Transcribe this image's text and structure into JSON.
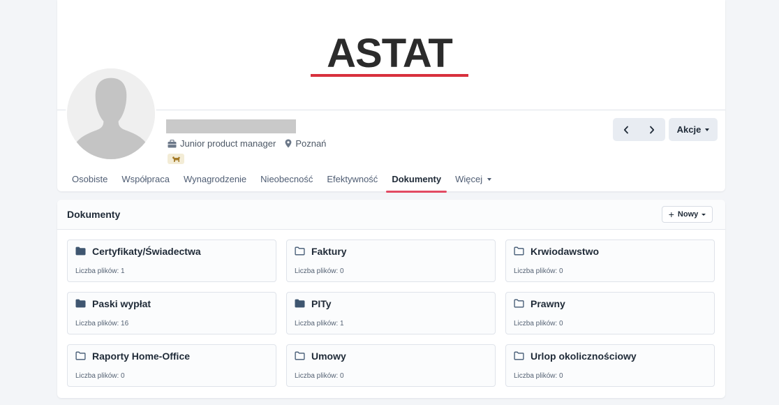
{
  "brand": {
    "logo_text": "ASTAT",
    "accent": "#d8303d"
  },
  "profile": {
    "job_title": "Junior product manager",
    "location": "Poznań",
    "actions_label": "Akcje"
  },
  "tabs": [
    {
      "label": "Osobiste",
      "active": false
    },
    {
      "label": "Współpraca",
      "active": false
    },
    {
      "label": "Wynagrodzenie",
      "active": false
    },
    {
      "label": "Nieobecność",
      "active": false
    },
    {
      "label": "Efektywność",
      "active": false
    },
    {
      "label": "Dokumenty",
      "active": true
    },
    {
      "label": "Więcej",
      "active": false
    }
  ],
  "documents": {
    "title": "Dokumenty",
    "new_label": "Nowy",
    "count_prefix": "Liczba plików:",
    "folders": [
      {
        "name": "Certyfikaty/Świadectwa",
        "count_text": "Liczba plików: 1",
        "icon": "folder-filled-icon"
      },
      {
        "name": "Faktury",
        "count_text": "Liczba plików: 0",
        "icon": "folder-outline-icon"
      },
      {
        "name": "Krwiodawstwo",
        "count_text": "Liczba plików: 0",
        "icon": "folder-outline-icon"
      },
      {
        "name": "Paski wypłat",
        "count_text": "Liczba plików: 16",
        "icon": "folder-filled-icon"
      },
      {
        "name": "PITy",
        "count_text": "Liczba plików: 1",
        "icon": "folder-filled-icon"
      },
      {
        "name": "Prawny",
        "count_text": "Liczba plików: 0",
        "icon": "folder-outline-icon"
      },
      {
        "name": "Raporty Home-Office",
        "count_text": "Liczba plików: 0",
        "icon": "folder-outline-icon"
      },
      {
        "name": "Umowy",
        "count_text": "Liczba plików: 0",
        "icon": "folder-outline-icon"
      },
      {
        "name": "Urlop okolicznościowy",
        "count_text": "Liczba plików: 0",
        "icon": "folder-outline-icon"
      }
    ]
  }
}
